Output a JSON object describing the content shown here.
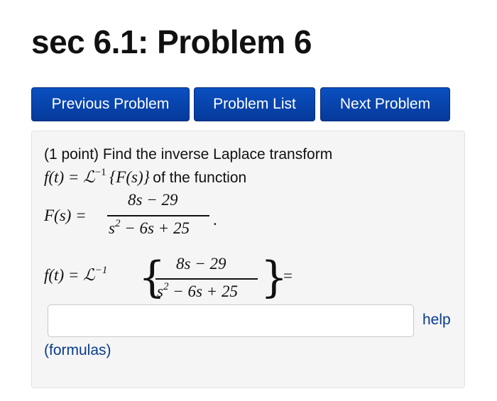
{
  "page": {
    "title": "sec 6.1: Problem 6"
  },
  "nav": {
    "previous_label": "Previous Problem",
    "list_label": "Problem List",
    "next_label": "Next Problem"
  },
  "problem": {
    "points": "(1 point)",
    "statement": "Find the inverse Laplace transform",
    "of_the_function": "of the function",
    "def_lhs": "f(t) = ℒ",
    "inverse_exp": "−1",
    "def_rhs": "{F(s)}",
    "F_lhs": "F(s) =",
    "numerator": "8s − 29",
    "denominator_base": "s",
    "denominator_exp": "2",
    "denominator_rest": " − 6s + 25",
    "period": ".",
    "answer_lhs": "f(t) = ℒ",
    "equals": "="
  },
  "answer": {
    "value": "",
    "placeholder": ""
  },
  "links": {
    "help": "help",
    "formulas": "(formulas)"
  }
}
